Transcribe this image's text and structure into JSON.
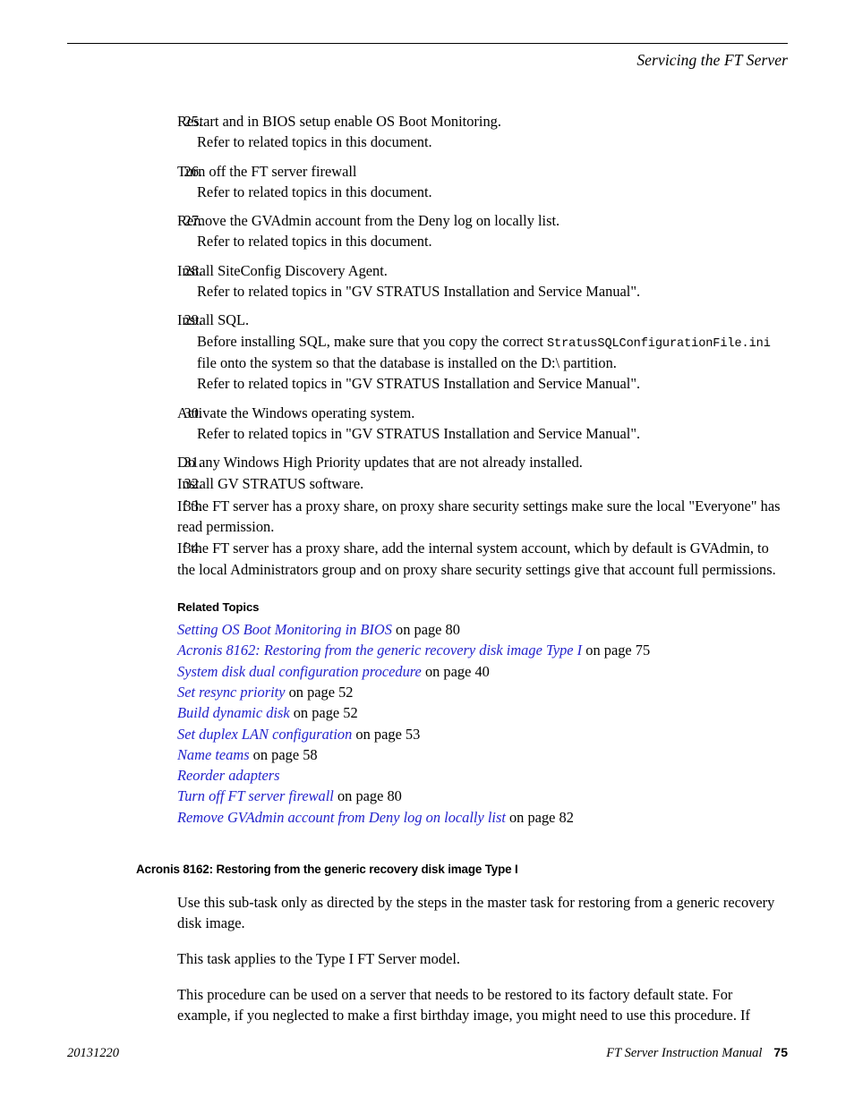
{
  "header": {
    "title": "Servicing the FT Server"
  },
  "steps": [
    {
      "num": "25.",
      "text": "Restart and in BIOS setup enable OS Boot Monitoring.",
      "sub": [
        "Refer to related topics in this document."
      ]
    },
    {
      "num": "26.",
      "text": "Turn off the FT server firewall",
      "sub": [
        "Refer to related topics in this document."
      ]
    },
    {
      "num": "27.",
      "text": "Remove the GVAdmin account from the Deny log on locally list.",
      "sub": [
        "Refer to related topics in this document."
      ]
    },
    {
      "num": "28.",
      "text": "Install SiteConfig Discovery Agent.",
      "sub": [
        "Refer to related topics in \"GV STRATUS Installation and Service Manual\"."
      ]
    },
    {
      "num": "29.",
      "text": "Install SQL.",
      "sub_pre": "Before installing SQL, make sure that you copy the correct ",
      "sub_code": "StratusSQLConfigurationFile.ini",
      "sub_post": " file onto the system so that the database is installed on the D:\\ partition.",
      "sub": [
        "Refer to related topics in \"GV STRATUS Installation and Service Manual\"."
      ]
    },
    {
      "num": "30.",
      "text": "Activate the Windows operating system.",
      "sub": [
        "Refer to related topics in \"GV STRATUS Installation and Service Manual\"."
      ]
    },
    {
      "num": "31.",
      "text": "Do any Windows High Priority updates that are not already installed.",
      "sub": []
    },
    {
      "num": "32.",
      "text": "Install GV STRATUS software.",
      "sub": []
    },
    {
      "num": "33.",
      "text": "If the FT server has a proxy share, on proxy share security settings make sure the local \"Everyone\" has read permission.",
      "sub": []
    },
    {
      "num": "34.",
      "text": "If the FT server has a proxy share, add the internal system account, which by default is GVAdmin, to the local Administrators group and on proxy share security settings give that account full permissions.",
      "sub": []
    }
  ],
  "related": {
    "heading": "Related Topics",
    "link_color": "#2222cc",
    "items": [
      {
        "link": "Setting OS Boot Monitoring in BIOS",
        "suffix": " on page 80"
      },
      {
        "link": "Acronis 8162: Restoring from the generic recovery disk image Type I",
        "suffix": " on page 75"
      },
      {
        "link": "System disk dual configuration procedure",
        "suffix": " on page 40"
      },
      {
        "link": "Set resync priority",
        "suffix": " on page 52"
      },
      {
        "link": "Build dynamic disk",
        "suffix": " on page 52"
      },
      {
        "link": "Set duplex LAN configuration",
        "suffix": " on page 53"
      },
      {
        "link": "Name teams",
        "suffix": " on page 58"
      },
      {
        "link": "Reorder adapters",
        "suffix": ""
      },
      {
        "link": "Turn off FT server firewall",
        "suffix": " on page 80"
      },
      {
        "link": "Remove GVAdmin account from Deny log on locally list",
        "suffix": " on page 82"
      }
    ]
  },
  "subsection": {
    "heading": "Acronis 8162: Restoring from the generic recovery disk image Type I",
    "paragraphs": [
      "Use this sub-task only as directed by the steps in the master task for restoring from a generic recovery disk image.",
      "This task applies to the Type I FT Server model.",
      "This procedure can be used on a server that needs to be restored to its factory default state. For example, if you neglected to make a first birthday image, you might need to use this procedure. If"
    ]
  },
  "footer": {
    "date_code": "20131220",
    "manual_title": "FT Server Instruction Manual",
    "page_number": "75"
  }
}
